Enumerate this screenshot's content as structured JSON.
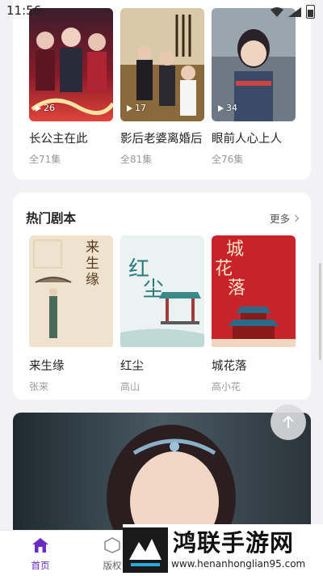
{
  "status_bar": {
    "time": "11:56"
  },
  "top_section": {
    "items": [
      {
        "title": "长公主在此",
        "episodes": "全71集",
        "plays": "26"
      },
      {
        "title": "影后老婆离婚后",
        "episodes": "全81集",
        "plays": "17"
      },
      {
        "title": "眼前人心上人",
        "episodes": "全76集",
        "plays": "34"
      }
    ]
  },
  "hot_scripts": {
    "title": "热门剧本",
    "more_label": "更多",
    "items": [
      {
        "title": "来生缘",
        "author": "张来"
      },
      {
        "title": "红尘",
        "author": "高山"
      },
      {
        "title": "城花落",
        "author": "高小花"
      }
    ],
    "cover_texts": {
      "laishengyuan": "来生缘",
      "hongchen": "红尘",
      "chenghualuo": "城花落"
    }
  },
  "tabbar": {
    "tabs": [
      {
        "label": "首页",
        "active": true
      },
      {
        "label": "版权",
        "active": false
      }
    ]
  },
  "watermark": {
    "name": "鸿联手游网",
    "url": "www.henanhonglian95.com"
  },
  "colors": {
    "accent": "#6a2cc4",
    "cover_red": "#c9232a"
  }
}
